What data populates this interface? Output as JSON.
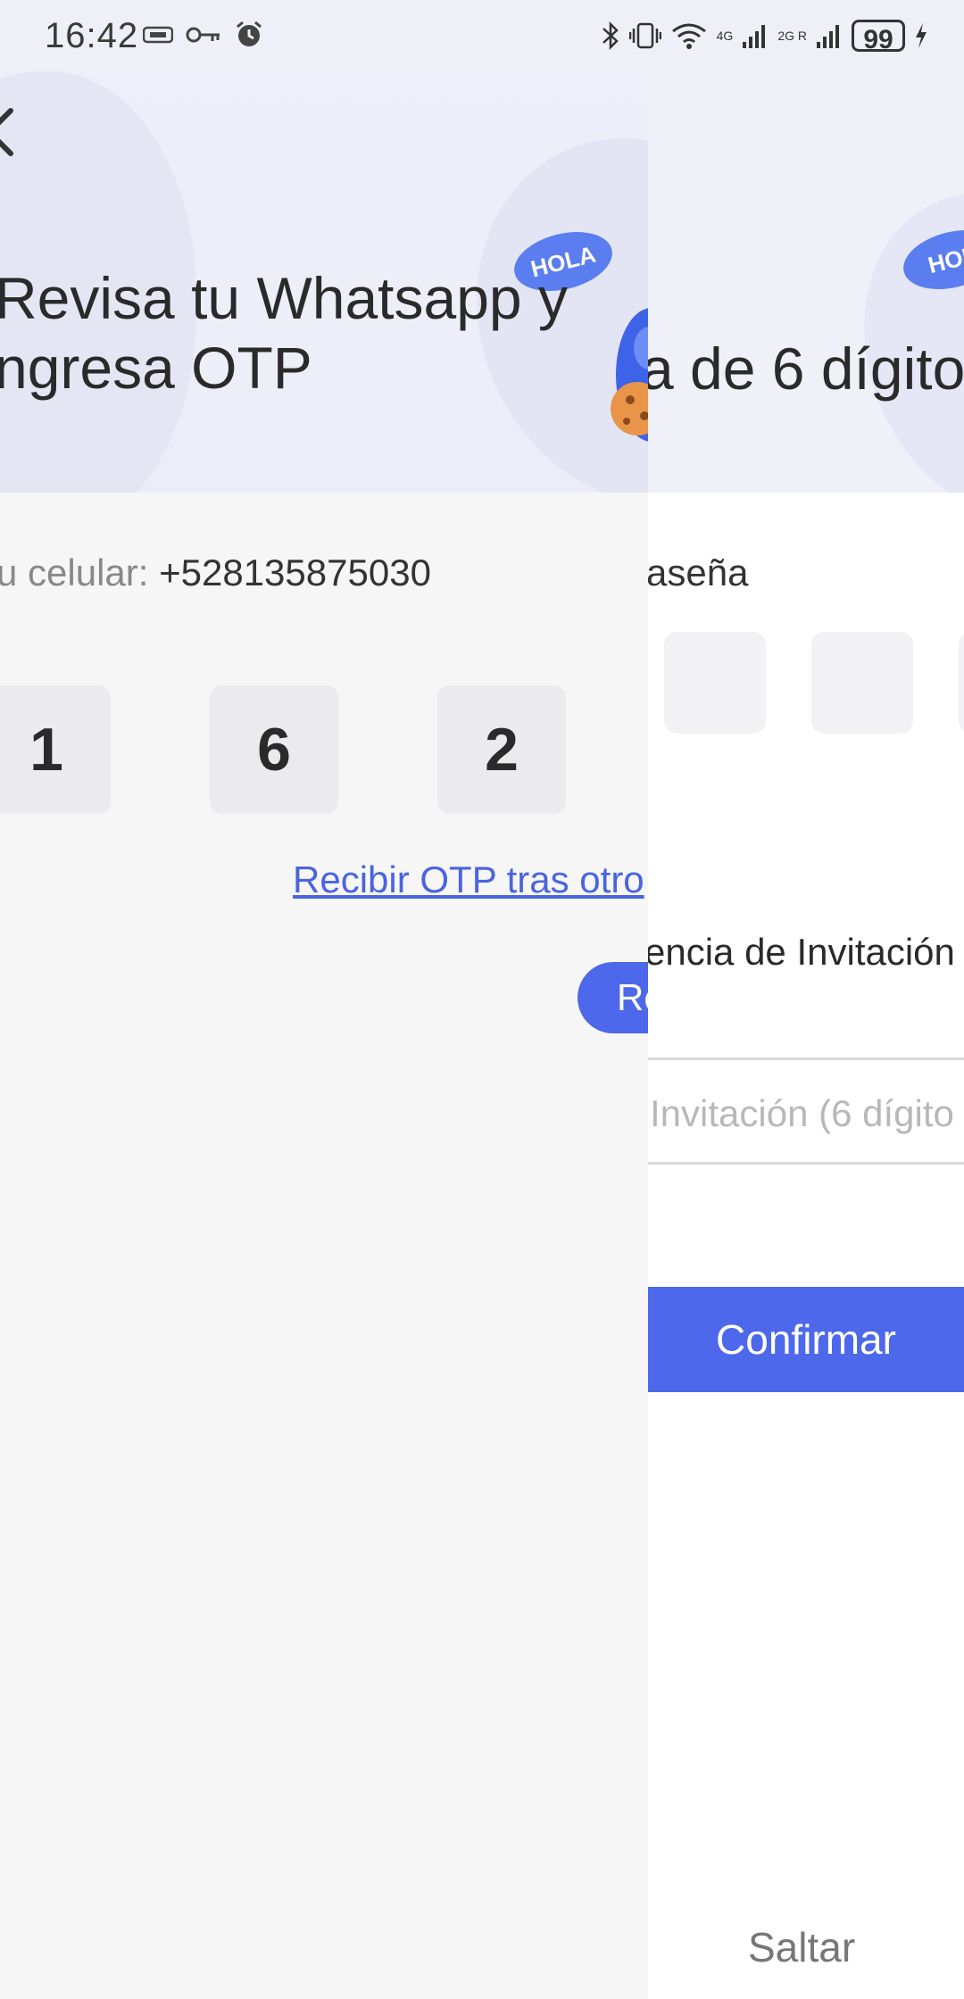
{
  "status_bar": {
    "time": "16:42",
    "network_left": "4G",
    "network_right": "2G R",
    "battery": "99"
  },
  "otp_screen": {
    "title_line1": "Revisa tu Whatsapp y",
    "title_line2": "ngresa OTP",
    "bubble": "HOLA",
    "phone_label": "u celular:",
    "phone_number": "+528135875030",
    "digits": [
      "1",
      "6",
      "2"
    ],
    "resend_link": "Recibir OTP tras otro",
    "resend_button": "Re"
  },
  "password_screen": {
    "bubble": "HOL",
    "title": "a de 6 dígito",
    "password_label": "aseña",
    "invite_label": "encia de Invitación",
    "invite_placeholder": "Invitación (6 dígito",
    "confirm_button": "Confirmar",
    "skip": "Saltar"
  },
  "colors": {
    "accent": "#4d68eb",
    "link": "#4a64e0",
    "header_bg": "#eff0f8"
  }
}
